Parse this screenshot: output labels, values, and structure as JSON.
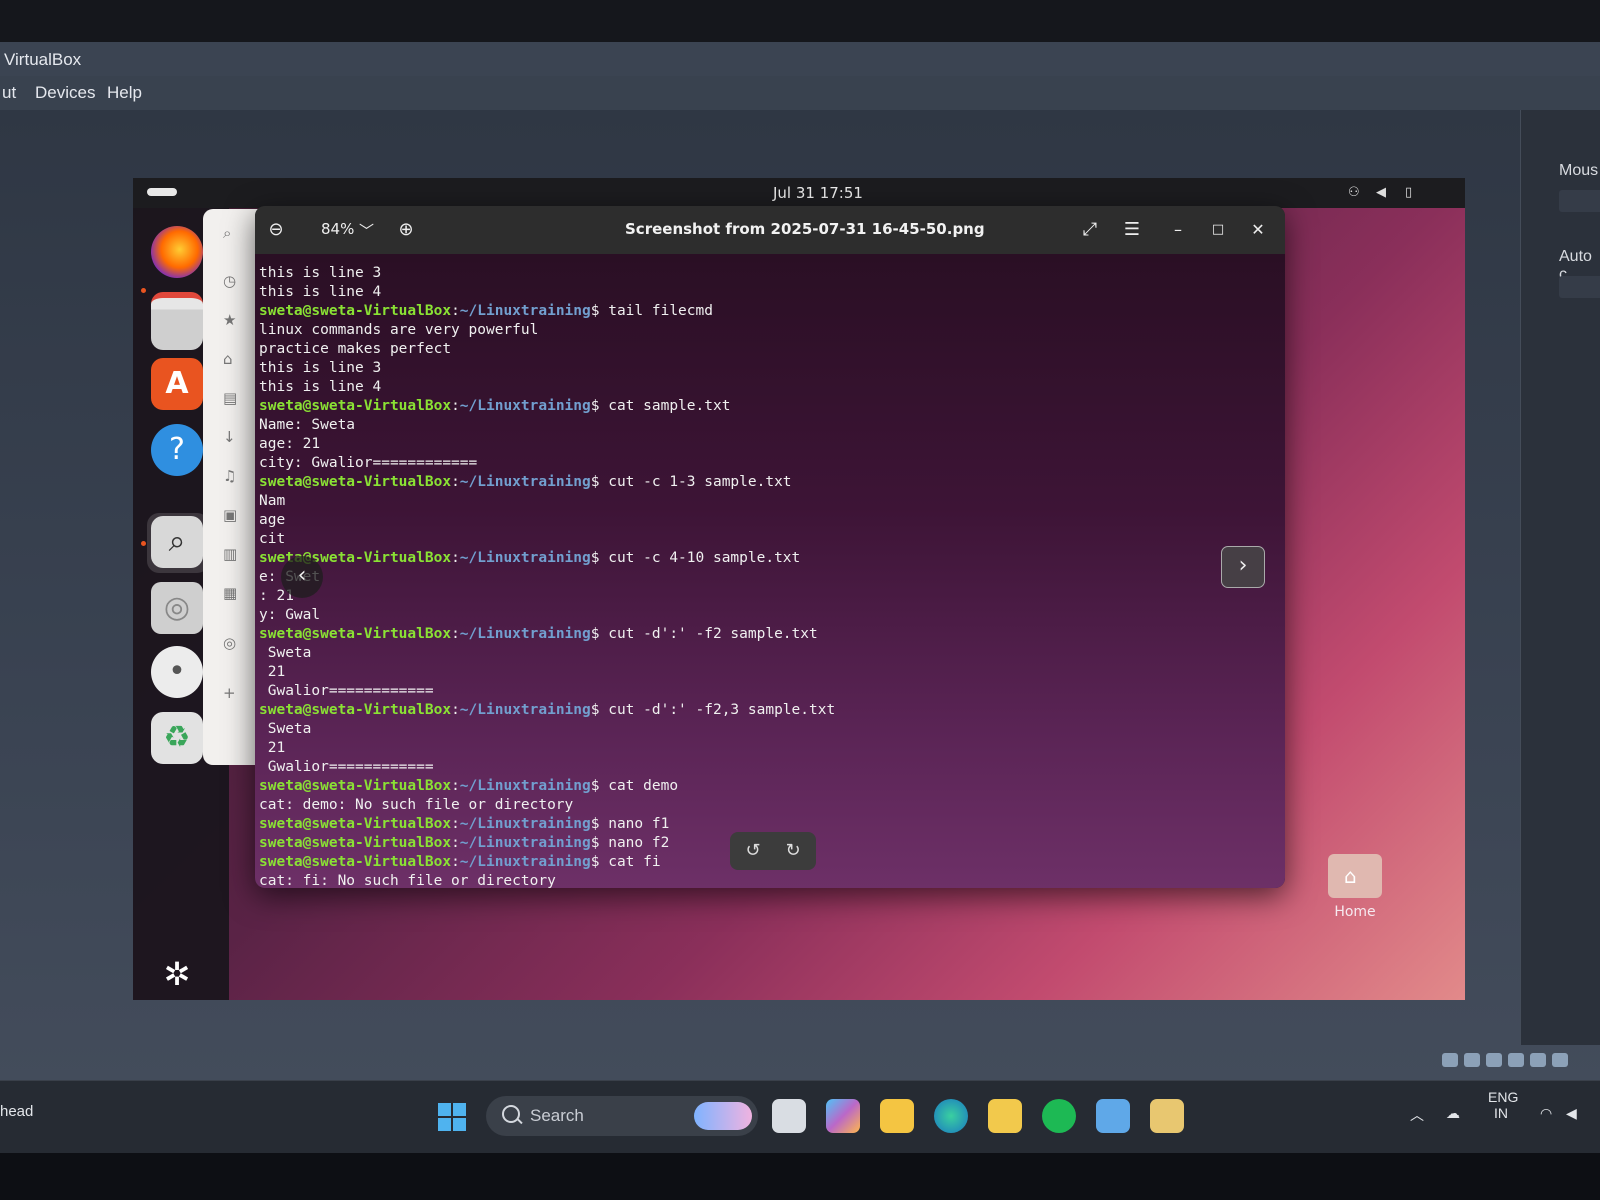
{
  "host": {
    "window_title": "VirtualBox",
    "menu": [
      "ut",
      "Devices",
      "Help"
    ],
    "right_panel": {
      "label1": "Mous",
      "label2": "Auto c"
    },
    "taskbar": {
      "left_text": "head",
      "search_placeholder": "Search",
      "lang_line1": "ENG",
      "lang_line2": "IN"
    }
  },
  "guest": {
    "clock": "Jul 31  17:51",
    "viewer": {
      "title": "Screenshot from 2025-07-31 16-45-50.png",
      "zoom": "84%"
    },
    "desktop_icon_label": "Home",
    "terminal_lines": [
      {
        "text": "this is line 3"
      },
      {
        "text": "this is line 4"
      },
      {
        "user": "sweta@sweta-VirtualBox",
        "path": "~/Linuxtraining",
        "cmd": "$ tail filecmd"
      },
      {
        "text": "linux commands are very powerful"
      },
      {
        "text": "practice makes perfect"
      },
      {
        "text": "this is line 3"
      },
      {
        "text": "this is line 4"
      },
      {
        "user": "sweta@sweta-VirtualBox",
        "path": "~/Linuxtraining",
        "cmd": "$ cat sample.txt"
      },
      {
        "text": "Name: Sweta"
      },
      {
        "text": "age: 21"
      },
      {
        "text": "city: Gwalior============"
      },
      {
        "user": "sweta@sweta-VirtualBox",
        "path": "~/Linuxtraining",
        "cmd": "$ cut -c 1-3 sample.txt"
      },
      {
        "text": "Nam"
      },
      {
        "text": "age"
      },
      {
        "text": "cit"
      },
      {
        "user": "sweta@sweta-VirtualBox",
        "path": "~/Linuxtraining",
        "cmd": "$ cut -c 4-10 sample.txt"
      },
      {
        "text": "e: Swet"
      },
      {
        "text": ": 21"
      },
      {
        "text": "y: Gwal"
      },
      {
        "user": "sweta@sweta-VirtualBox",
        "path": "~/Linuxtraining",
        "cmd": "$ cut -d':' -f2 sample.txt"
      },
      {
        "text": " Sweta"
      },
      {
        "text": " 21"
      },
      {
        "text": " Gwalior============"
      },
      {
        "user": "sweta@sweta-VirtualBox",
        "path": "~/Linuxtraining",
        "cmd": "$ cut -d':' -f2,3 sample.txt"
      },
      {
        "text": " Sweta"
      },
      {
        "text": " 21"
      },
      {
        "text": " Gwalior============"
      },
      {
        "user": "sweta@sweta-VirtualBox",
        "path": "~/Linuxtraining",
        "cmd": "$ cat demo"
      },
      {
        "text": "cat: demo: No such file or directory"
      },
      {
        "user": "sweta@sweta-VirtualBox",
        "path": "~/Linuxtraining",
        "cmd": "$ nano f1"
      },
      {
        "user": "sweta@sweta-VirtualBox",
        "path": "~/Linuxtraining",
        "cmd": "$ nano f2"
      },
      {
        "user": "sweta@sweta-VirtualBox",
        "path": "~/Linuxtraining",
        "cmd": "$ cat fi"
      },
      {
        "text": "cat: fi: No such file or directory"
      }
    ]
  }
}
